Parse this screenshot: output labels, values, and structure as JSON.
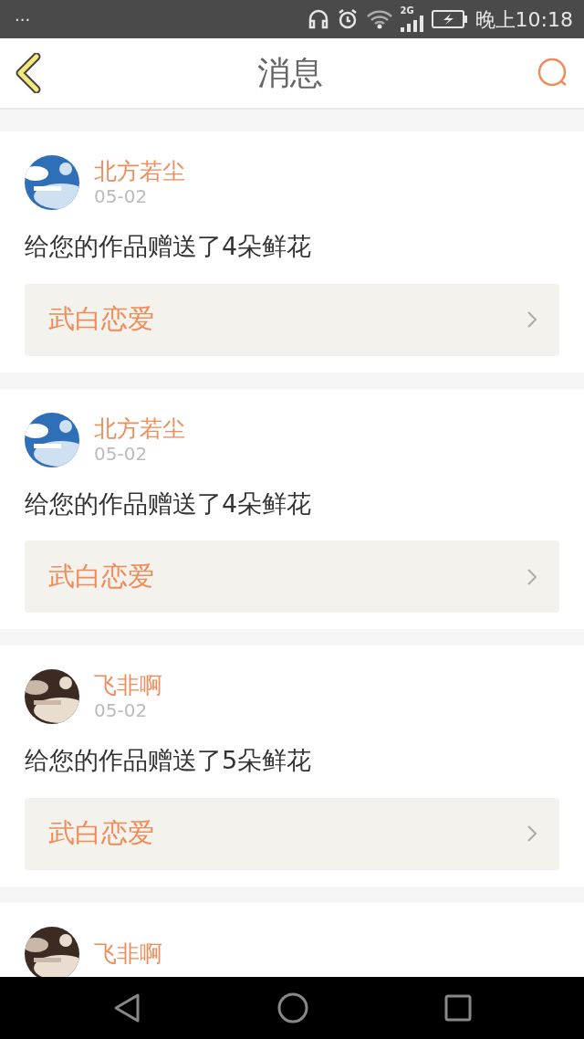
{
  "status_bar": {
    "dots": "···",
    "network": "2G",
    "time": "晚上10:18"
  },
  "header": {
    "title": "消息"
  },
  "messages": [
    {
      "name": "北方若尘",
      "date": "05-02",
      "text": "给您的作品赠送了4朵鲜花",
      "work": "武白恋爱"
    },
    {
      "name": "北方若尘",
      "date": "05-02",
      "text": "给您的作品赠送了4朵鲜花",
      "work": "武白恋爱"
    },
    {
      "name": "飞非啊",
      "date": "05-02",
      "text": "给您的作品赠送了5朵鲜花",
      "work": "武白恋爱"
    },
    {
      "name": "飞非啊"
    }
  ]
}
